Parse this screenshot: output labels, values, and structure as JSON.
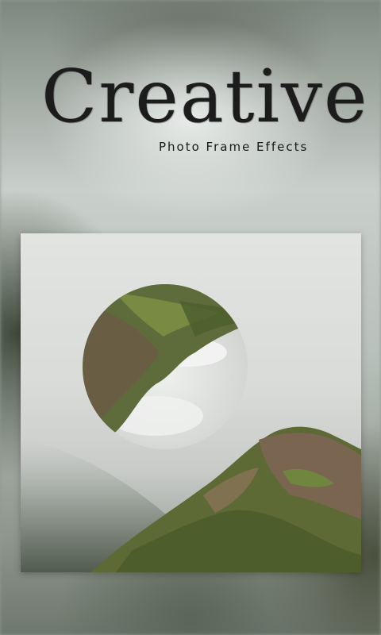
{
  "header": {
    "logo_text": "Creative",
    "subtitle": "Photo Frame Effects"
  },
  "preview": {
    "effect": "circle-mirror"
  },
  "colors": {
    "logo": "#1c1c1c",
    "fog": "#e2e4e2",
    "moss": "#5f7a3a",
    "rock": "#6b5a45"
  }
}
